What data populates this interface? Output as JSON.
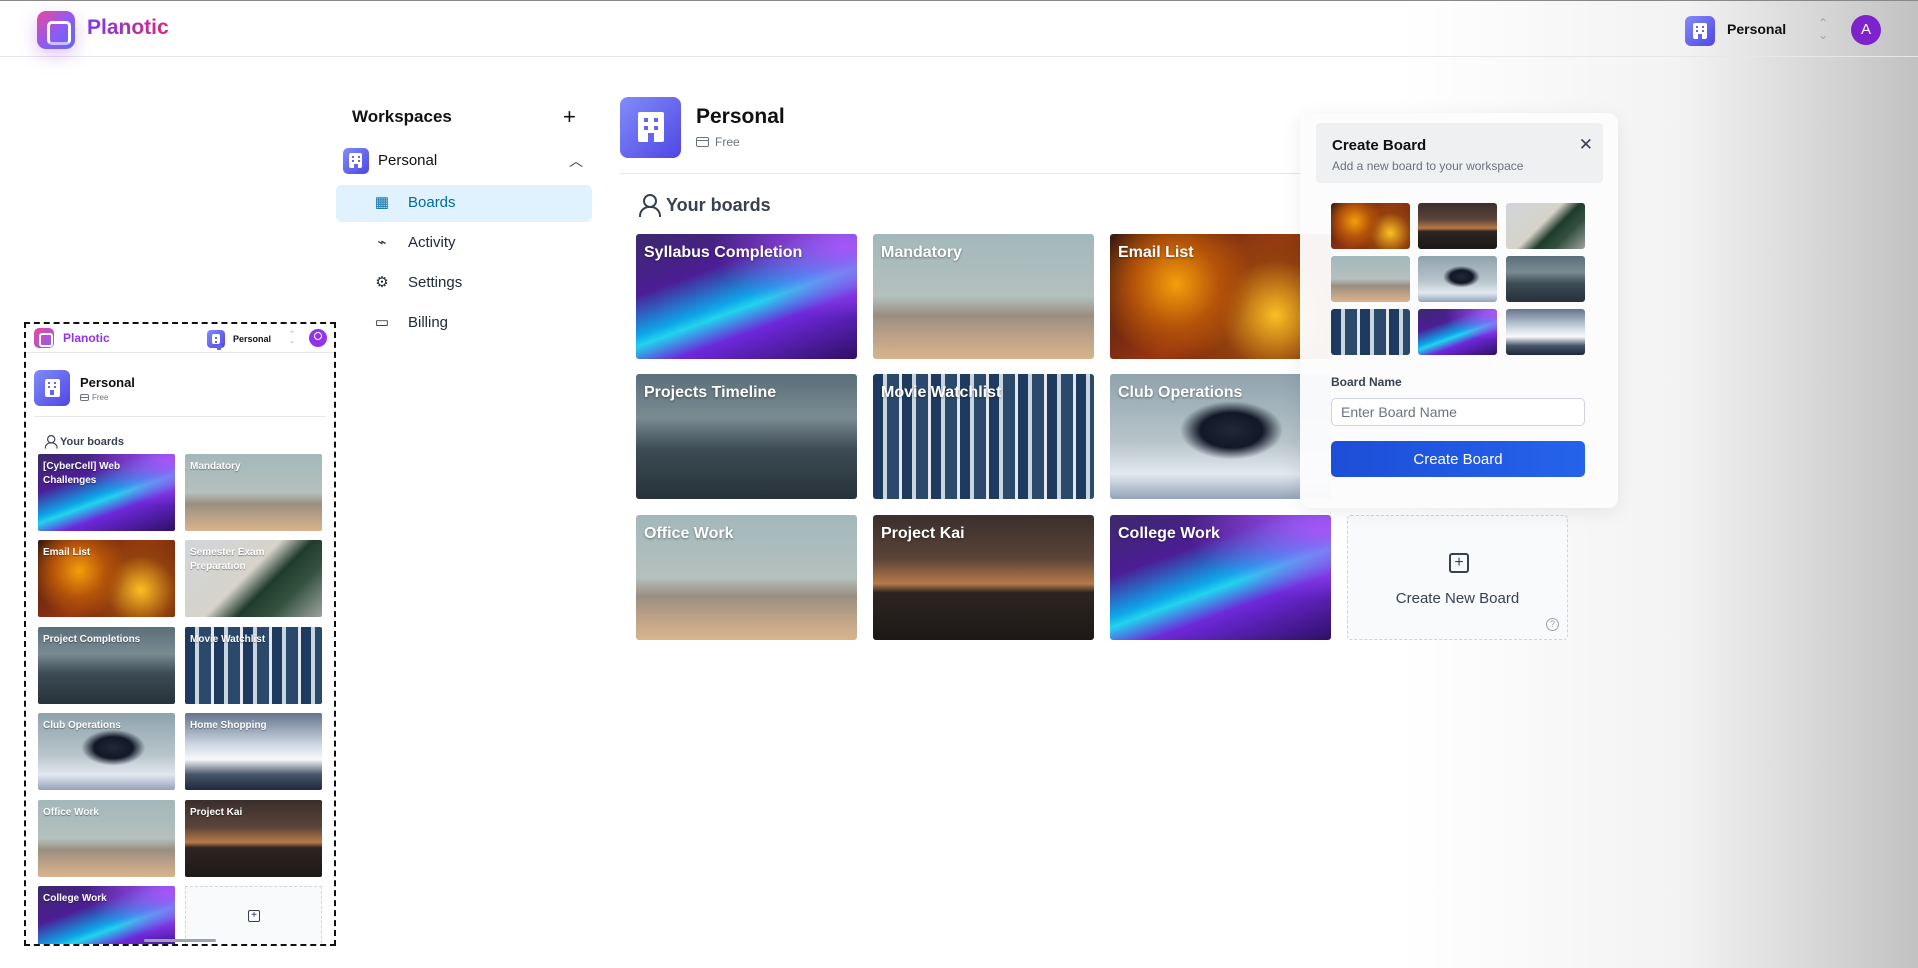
{
  "header": {
    "brand": "Planotic",
    "workspace_name": "Personal",
    "avatar_initial": "A",
    "switcher_glyph": "⌃⌄"
  },
  "sidebar": {
    "title": "Workspaces",
    "add_glyph": "+",
    "workspace": {
      "name": "Personal",
      "chevron": "︿"
    },
    "items": [
      {
        "label": "Boards",
        "icon": "layout-icon",
        "glyph": "▦",
        "active": true
      },
      {
        "label": "Activity",
        "icon": "activity-icon",
        "glyph": "⌁",
        "active": false
      },
      {
        "label": "Settings",
        "icon": "gear-icon",
        "glyph": "⚙",
        "active": false
      },
      {
        "label": "Billing",
        "icon": "credit-card-icon",
        "glyph": "▭",
        "active": false
      }
    ]
  },
  "main": {
    "workspace_title": "Personal",
    "plan": "Free",
    "boards_heading": "Your boards",
    "boards": [
      {
        "title": "Syllabus Completion",
        "bg": "wave"
      },
      {
        "title": "Mandatory",
        "bg": "desert"
      },
      {
        "title": "Email List",
        "bg": "leaves"
      },
      {
        "title": "Projects Timeline",
        "bg": "sea"
      },
      {
        "title": "Movie Watchlist",
        "bg": "city"
      },
      {
        "title": "Club Operations",
        "bg": "bird"
      },
      {
        "title": "Office Work",
        "bg": "desert"
      },
      {
        "title": "Project Kai",
        "bg": "mount"
      },
      {
        "title": "College Work",
        "bg": "wave"
      }
    ],
    "create_new_label": "Create New Board",
    "help_glyph": "?"
  },
  "popup": {
    "title": "Create Board",
    "subtitle": "Add a new board to your workspace",
    "close_glyph": "✕",
    "thumbnails": [
      "leaves",
      "mount",
      "palm",
      "desert",
      "bird",
      "sea",
      "city",
      "wave",
      "snow"
    ],
    "board_name_label": "Board Name",
    "board_name_placeholder": "Enter Board Name",
    "board_name_value": "",
    "submit_label": "Create Board"
  },
  "mobile": {
    "brand": "Planotic",
    "workspace_name": "Personal",
    "workspace_title": "Personal",
    "plan": "Free",
    "boards_heading": "Your boards",
    "boards": [
      {
        "title": "[CyberCell] Web Challenges",
        "bg": "wave"
      },
      {
        "title": "Mandatory",
        "bg": "desert"
      },
      {
        "title": "Email List",
        "bg": "leaves"
      },
      {
        "title": "Semester Exam Preparation",
        "bg": "palm"
      },
      {
        "title": "Project Completions",
        "bg": "sea"
      },
      {
        "title": "Movie Watchlist",
        "bg": "city"
      },
      {
        "title": "Club Operations",
        "bg": "bird"
      },
      {
        "title": "Home Shopping",
        "bg": "snow"
      },
      {
        "title": "Office Work",
        "bg": "desert"
      },
      {
        "title": "Project Kai",
        "bg": "mount"
      },
      {
        "title": "College Work",
        "bg": "wave"
      }
    ]
  },
  "colors": {
    "accent": "#2563eb",
    "brand_gradient_start": "#7c3aed",
    "brand_gradient_end": "#db2777",
    "active_nav_bg": "#e0f2fe",
    "active_nav_text": "#0369a1"
  }
}
